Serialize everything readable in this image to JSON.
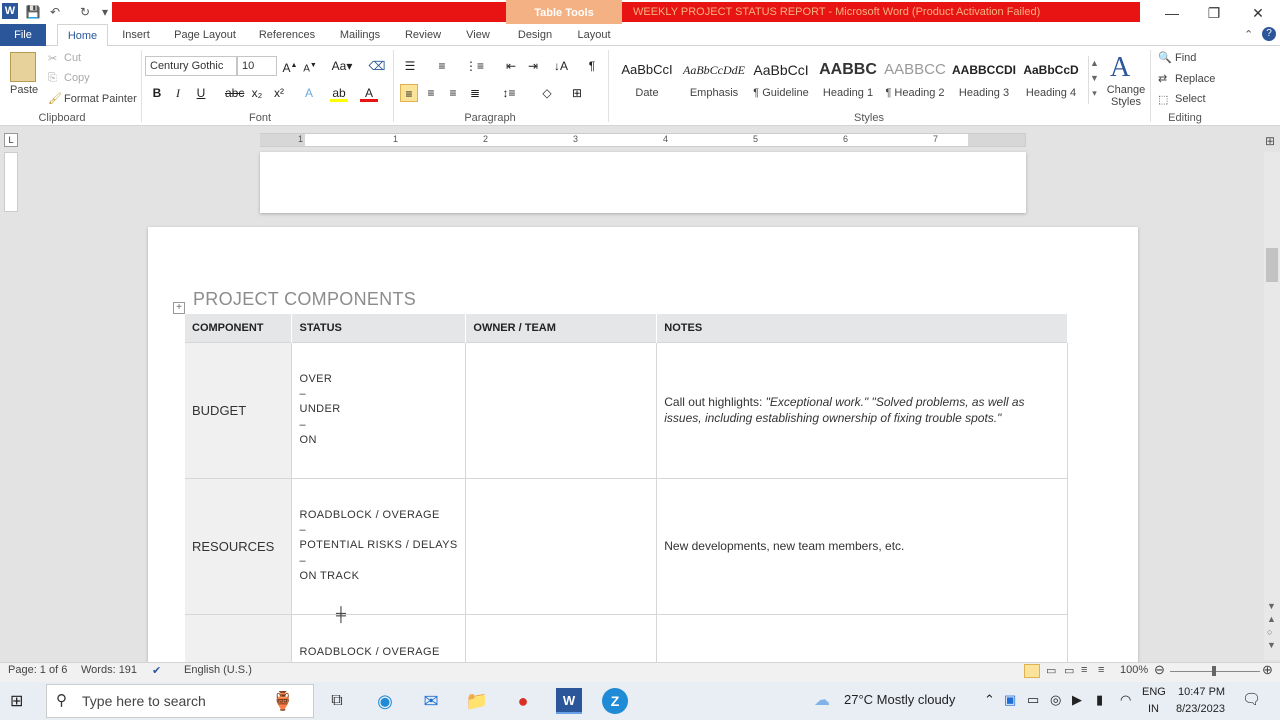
{
  "window": {
    "title": "WEEKLY PROJECT STATUS REPORT  -  Microsoft Word (Product Activation Failed)",
    "context_tab": "Table Tools"
  },
  "tabs": [
    "File",
    "Home",
    "Insert",
    "Page Layout",
    "References",
    "Mailings",
    "Review",
    "View",
    "Design",
    "Layout"
  ],
  "clipboard": {
    "paste": "Paste",
    "cut": "Cut",
    "copy": "Copy",
    "format_painter": "Format Painter",
    "label": "Clipboard"
  },
  "font": {
    "name": "Century Gothic",
    "size": "10",
    "label": "Font"
  },
  "paragraph": {
    "label": "Paragraph"
  },
  "styles": {
    "items": [
      {
        "preview": "AaBbCcI",
        "name": "Date"
      },
      {
        "preview": "AaBbCcDdE",
        "name": "Emphasis"
      },
      {
        "preview": "AaBbCcI",
        "name": "¶ Guideline"
      },
      {
        "preview": "AABBC",
        "name": "Heading 1"
      },
      {
        "preview": "AABBCC",
        "name": "¶ Heading 2"
      },
      {
        "preview": "AABBCCDI",
        "name": "Heading 3"
      },
      {
        "preview": "AaBbCcD",
        "name": "Heading 4"
      }
    ],
    "change_styles": "Change Styles",
    "label": "Styles"
  },
  "editing": {
    "find": "Find",
    "replace": "Replace",
    "select": "Select",
    "label": "Editing"
  },
  "ruler": {
    "numbers": [
      "1",
      "1",
      "2",
      "3",
      "4",
      "5",
      "6",
      "7"
    ]
  },
  "document": {
    "section_title": "PROJECT COMPONENTS",
    "table": {
      "headers": [
        "COMPONENT",
        "STATUS",
        "OWNER / TEAM",
        "NOTES"
      ],
      "rows": [
        {
          "component": "BUDGET",
          "status_lines": [
            "OVER",
            "–",
            "UNDER",
            "–",
            "ON"
          ],
          "owner": "",
          "note_prefix": "Call out highlights: ",
          "note_italic": "\"Exceptional work.\" \"Solved problems, as well as issues, including establishing ownership of fixing trouble spots.\""
        },
        {
          "component": "RESOURCES",
          "status_lines": [
            "ROADBLOCK / OVERAGE",
            "–",
            "POTENTIAL RISKS / DELAYS",
            "–",
            "ON TRACK"
          ],
          "owner": "",
          "note_prefix": "New developments, new team members, etc.",
          "note_italic": ""
        },
        {
          "component": "",
          "status_lines": [
            "ROADBLOCK / OVERAGE"
          ],
          "owner": "",
          "note_prefix": "",
          "note_italic": ""
        }
      ]
    }
  },
  "statusbar": {
    "page": "Page: 1 of 6",
    "words": "Words: 191",
    "language": "English (U.S.)",
    "zoom": "100%"
  },
  "taskbar": {
    "search_placeholder": "Type here to search",
    "weather": "27°C  Mostly cloudy",
    "lang_top": "ENG",
    "lang_bottom": "IN",
    "time": "10:47 PM",
    "date": "8/23/2023"
  },
  "colors": {
    "accent": "#2b579a",
    "titlebar_red": "#e81313",
    "table_tools": "#f4b183"
  }
}
